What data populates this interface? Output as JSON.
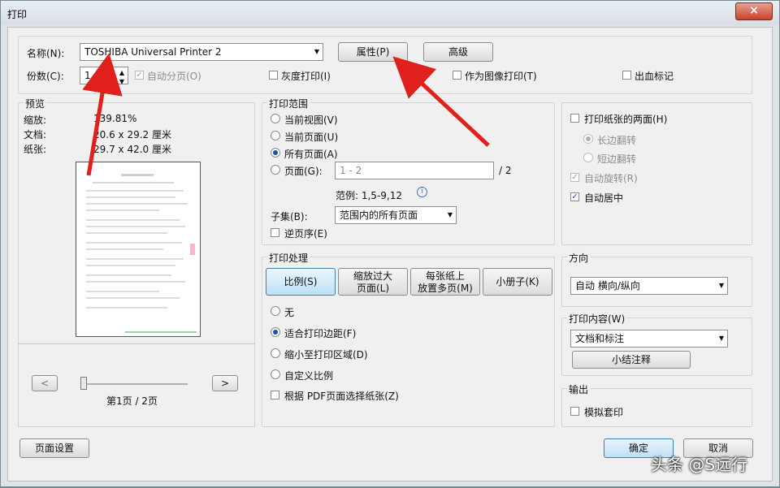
{
  "window": {
    "title": "打印",
    "close": "×"
  },
  "printer": {
    "name_label": "名称(N):",
    "name_value": "TOSHIBA Universal Printer 2",
    "properties": "属性(P)",
    "advanced": "高级",
    "copies_label": "份数(C):",
    "copies_value": "1",
    "collate": "自动分页(O)",
    "grayscale": "灰度打印(I)",
    "print_as_image": "作为图像打印(T)",
    "bleed": "出血标记"
  },
  "preview": {
    "title": "预览",
    "zoom_label": "缩放:",
    "zoom_value": "139.81%",
    "doc_label": "文档:",
    "doc_value": "20.6 x 29.2 厘米",
    "paper_label": "纸张:",
    "paper_value": "29.7 x 42.0 厘米",
    "prev": "<",
    "next": ">",
    "page_info": "第1页 / 2页"
  },
  "range": {
    "title": "打印范围",
    "current_view": "当前视图(V)",
    "current_page": "当前页面(U)",
    "all_pages": "所有页面(A)",
    "pages": "页面(G):",
    "pages_placeholder": "1 - 2",
    "pages_total": "/ 2",
    "example": "范例: 1,5-9,12",
    "subset_label": "子集(B):",
    "subset_value": "范围内的所有页面",
    "reverse": "逆页序(E)"
  },
  "handling": {
    "title": "打印处理",
    "tabs": [
      "比例(S)",
      "缩放过大\n页面(L)",
      "每张纸上\n放置多页(M)",
      "小册子(K)"
    ],
    "none": "无",
    "fit": "适合打印边距(F)",
    "shrink": "缩小至打印区域(D)",
    "custom": "自定义比例",
    "choose_paper": "根据 PDF页面选择纸张(Z)"
  },
  "duplex": {
    "both_sides": "打印纸张的两面(H)",
    "long_edge": "长边翻转",
    "short_edge": "短边翻转",
    "auto_rotate": "自动旋转(R)",
    "auto_center": "自动居中"
  },
  "orientation": {
    "title": "方向",
    "value": "自动 横向/纵向"
  },
  "content": {
    "title": "打印内容(W)",
    "value": "文档和标注",
    "summarize": "小结注释"
  },
  "output": {
    "title": "输出",
    "simulate": "模拟套印"
  },
  "footer": {
    "page_setup": "页面设置",
    "ok": "确定",
    "cancel": "取消"
  },
  "watermark": "头条 @S远行",
  "colors": {
    "accent": "#1b4fa8",
    "arrow": "#e0201c"
  }
}
